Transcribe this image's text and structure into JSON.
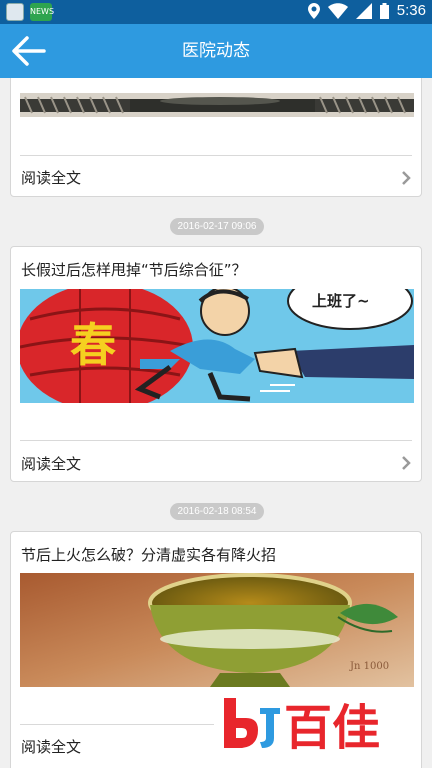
{
  "status_bar": {
    "time": "5:36",
    "app_icon_2_text": "NEWS"
  },
  "header": {
    "title": "医院动态",
    "back_icon": "arrow-left-icon"
  },
  "articles": [
    {
      "title": "",
      "read_more": "阅读全文"
    },
    {
      "date": "2016-02-17 09:06",
      "title": "长假过后怎样甩掉“节后综合征”？",
      "image_text_1": "春",
      "image_text_2": "上班了~",
      "read_more": "阅读全文"
    },
    {
      "date": "2016-02-18 08:54",
      "title": "节后上火怎么破？分清虚实各有降火招",
      "image_cup_text": "Jn 1000",
      "read_more": "阅读全文"
    }
  ],
  "watermark": {
    "text": "百佳"
  },
  "colors": {
    "title_bar": "#2e9ae0",
    "status_bar": "#0e5f9e",
    "watermark_red": "#e8262c"
  }
}
